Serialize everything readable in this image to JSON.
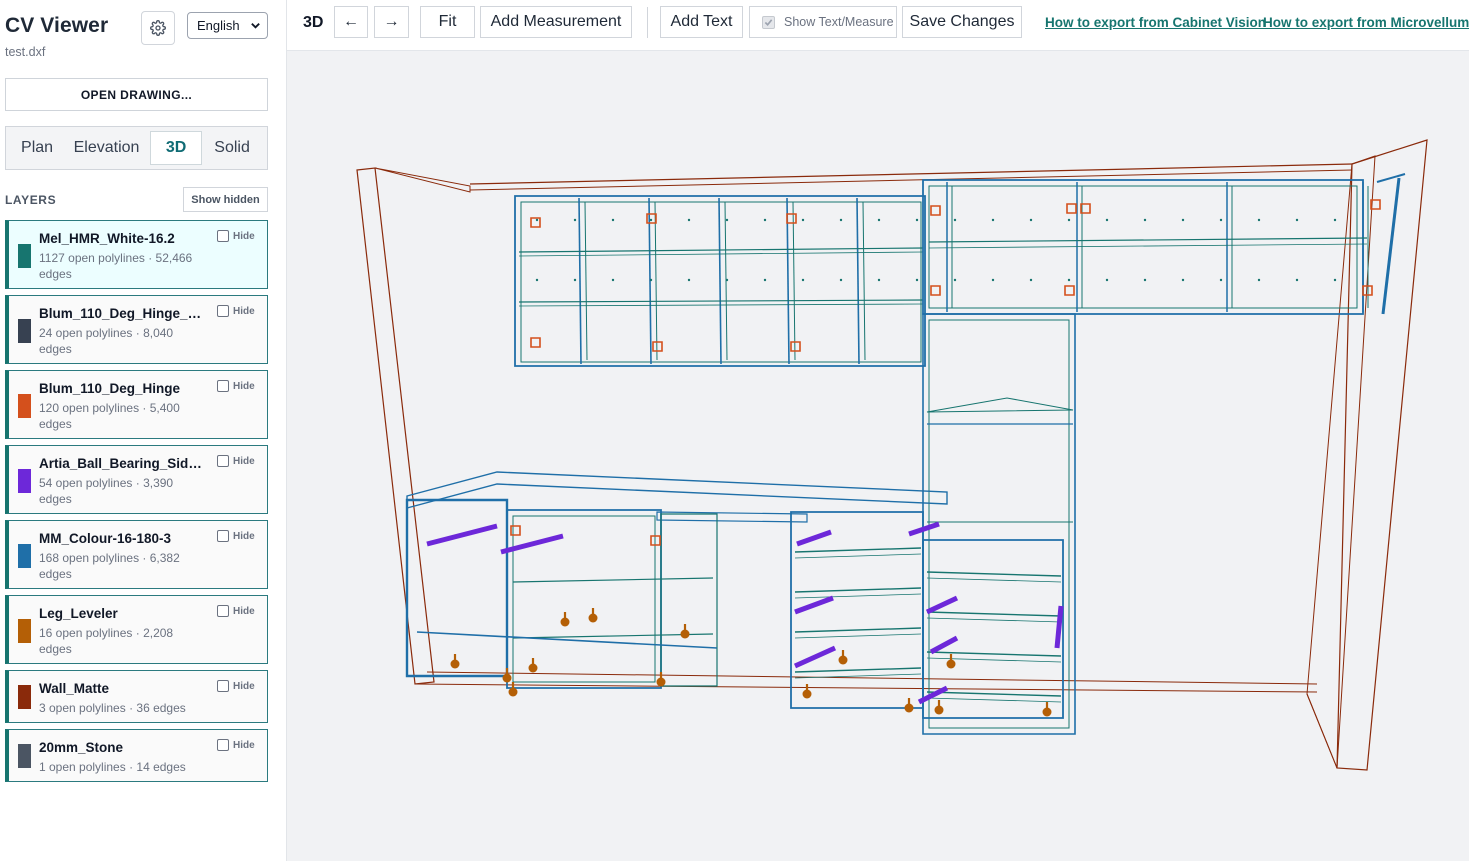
{
  "app": {
    "title": "CV Viewer",
    "file": "test.dxf"
  },
  "language": {
    "selected": "English"
  },
  "open_button": "OPEN DRAWING...",
  "view_tabs": [
    {
      "label": "Plan",
      "active": false
    },
    {
      "label": "Elevation",
      "active": false
    },
    {
      "label": "3D",
      "active": true
    },
    {
      "label": "Solid",
      "active": false
    }
  ],
  "layers_panel": {
    "heading": "LAYERS",
    "show_hidden": "Show hidden",
    "hide_label": "Hide"
  },
  "layers": [
    {
      "name": "Mel_HMR_White-16.2",
      "stats": "1127 open polylines · 52,466 edges",
      "color": "#17756f",
      "selected": true
    },
    {
      "name": "Blum_110_Deg_Hinge_Pl...",
      "stats": "24 open polylines · 8,040 edges",
      "color": "#374151",
      "selected": false
    },
    {
      "name": "Blum_110_Deg_Hinge",
      "stats": "120 open polylines · 5,400 edges",
      "color": "#d4501c",
      "selected": false
    },
    {
      "name": "Artia_Ball_Bearing_Side_...",
      "stats": "54 open polylines · 3,390 edges",
      "color": "#6d28d9",
      "selected": false
    },
    {
      "name": "MM_Colour-16-180-3",
      "stats": "168 open polylines · 6,382 edges",
      "color": "#1f6fa8",
      "selected": false
    },
    {
      "name": "Leg_Leveler",
      "stats": "16 open polylines · 2,208 edges",
      "color": "#b45f06",
      "selected": false
    },
    {
      "name": "Wall_Matte",
      "stats": "3 open polylines · 36 edges",
      "color": "#8a2a0b",
      "selected": false
    },
    {
      "name": "20mm_Stone",
      "stats": "1 open polylines · 14 edges",
      "color": "#4b5563",
      "selected": false
    }
  ],
  "toolbar": {
    "mode_label": "3D",
    "rotate_left": "←",
    "rotate_right": "→",
    "fit": "Fit",
    "add_measurement": "Add Measurement",
    "add_text": "Add Text",
    "show_text_measure": "Show Text/Measure",
    "save_changes": "Save Changes",
    "link_cabinet_vision": "How to export from Cabinet Vision",
    "link_microvellum": "How to export from Microvellum"
  },
  "colors": {
    "accent": "#17756f",
    "cabinet": "#17756f",
    "panel": "#1f6fa8",
    "wall": "#8a2a0b",
    "hinge": "#d4501c",
    "slide": "#6d28d9",
    "leg": "#b45f06"
  }
}
